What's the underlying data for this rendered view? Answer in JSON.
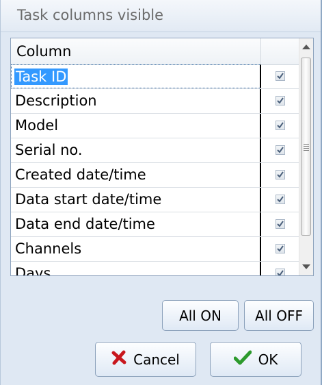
{
  "dialog": {
    "title": "Task columns visible"
  },
  "grid": {
    "header": "Column",
    "rows": [
      {
        "name": "Task ID",
        "checked": true,
        "selected": true
      },
      {
        "name": "Description",
        "checked": true
      },
      {
        "name": "Model",
        "checked": true
      },
      {
        "name": "Serial no.",
        "checked": true
      },
      {
        "name": "Created date/time",
        "checked": true
      },
      {
        "name": "Data start date/time",
        "checked": true
      },
      {
        "name": "Data end date/time",
        "checked": true
      },
      {
        "name": "Channels",
        "checked": true
      },
      {
        "name": "Days",
        "checked": true
      }
    ]
  },
  "buttons": {
    "all_on": "All ON",
    "all_off": "All OFF",
    "cancel": "Cancel",
    "ok": "OK"
  },
  "icons": {
    "cancel": "red-x-icon",
    "ok": "green-check-icon",
    "check": "checkmark-icon"
  },
  "colors": {
    "selection": "#3399ff",
    "cancel_icon": "#c8171e",
    "ok_icon": "#2d9a2d"
  }
}
